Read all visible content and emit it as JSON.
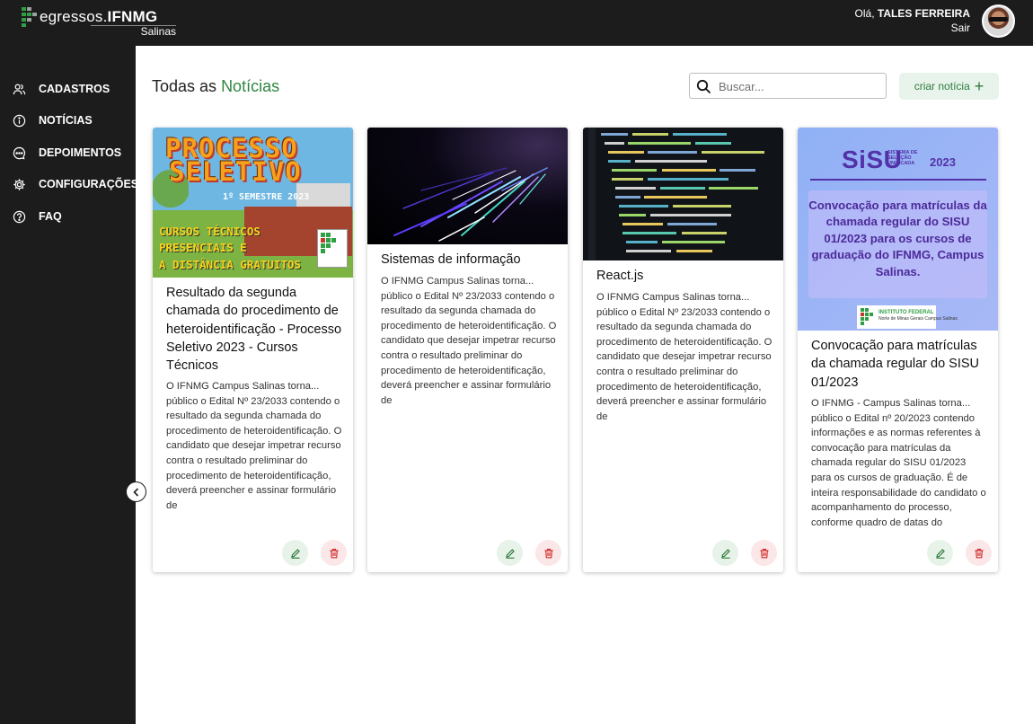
{
  "brand": {
    "prefix": "egressos.",
    "name": "IFNMG",
    "campus": "Salinas"
  },
  "user": {
    "greeting": "Olá,",
    "name": "TALES FERREIRA",
    "logout": "Sair"
  },
  "sidebar": {
    "items": [
      {
        "label": "CADASTROS",
        "icon": "users-icon"
      },
      {
        "label": "NOTÍCIAS",
        "icon": "info-icon"
      },
      {
        "label": "DEPOIMENTOS",
        "icon": "chat-icon"
      },
      {
        "label": "CONFIGURAÇÕES",
        "icon": "gear-icon"
      },
      {
        "label": "FAQ",
        "icon": "help-icon"
      }
    ],
    "collapse_icon": "chevron-left-icon"
  },
  "header": {
    "title_prefix": "Todas as",
    "title_accent": "Notícias",
    "search_placeholder": "Buscar...",
    "create_label": "criar notícia",
    "create_icon": "+"
  },
  "colors": {
    "sidebar_bg": "#1c1c1c",
    "accent_green": "#2e8540",
    "edit_bg": "#e7f2e9",
    "delete_bg": "#fbe7e7",
    "delete_red": "#d32f2f"
  },
  "news": [
    {
      "title": "Resultado da segunda chamada do procedimento de heteroidentificação - Processo Seletivo 2023 - Cursos Técnicos",
      "excerpt": "O IFNMG Campus Salinas torna... público o Edital Nº 23/2033 contendo o resultado da segunda chamada do procedimento de heteroidentificação. O candidato que desejar impetrar recurso contra o resultado preliminar do procedimento de heteroidentificação, deverá preencher e assinar formulário de",
      "image": {
        "line1": "PROCESSO",
        "line2": "SELETIVO",
        "semester": "1º SEMESTRE 2023",
        "course1": "CURSOS TÉCNICOS",
        "course2": "PRESENCIAIS E",
        "course3": "A DISTÂNCIA GRATUITOS",
        "seal": "INSTITUTO FEDERAL Norte de Minas Gerais"
      }
    },
    {
      "title": "Sistemas de informação",
      "excerpt": "O IFNMG Campus Salinas torna... público o Edital Nº 23/2033 contendo o resultado da segunda chamada do procedimento de heteroidentificação. O candidato que desejar impetrar recurso contra o resultado preliminar do procedimento de heteroidentificação, deverá preencher e assinar formulário de"
    },
    {
      "title": "React.js",
      "excerpt": "O IFNMG Campus Salinas torna... público o Edital Nº 23/2033 contendo o resultado da segunda chamada do procedimento de heteroidentificação. O candidato que desejar impetrar recurso contra o resultado preliminar do procedimento de heteroidentificação, deverá preencher e assinar formulário de"
    },
    {
      "title": "Convocação para matrículas da chamada regular do SISU 01/2023",
      "excerpt": "O IFNMG - Campus Salinas torna... público o Edital nº 20/2023 contendo informações e as normas referentes à convocação para matrículas da chamada regular do SISU 01/2023 para os cursos de graduação. É de inteira responsabilidade do candidato o acompanhamento do processo, conforme quadro de datas do",
      "image": {
        "logo": "SiSU",
        "logo_sub": "SISTEMA DE SELEÇÃO UNIFICADA",
        "year": "2023",
        "headline": "Convocação para matrículas da chamada regular do SISU 01/2023 para os cursos de graduação do IFNMG, Campus Salinas.",
        "seal_title": "INSTITUTO FEDERAL",
        "seal_sub": "Norte de Minas Gerais Campus Salinas"
      }
    }
  ]
}
